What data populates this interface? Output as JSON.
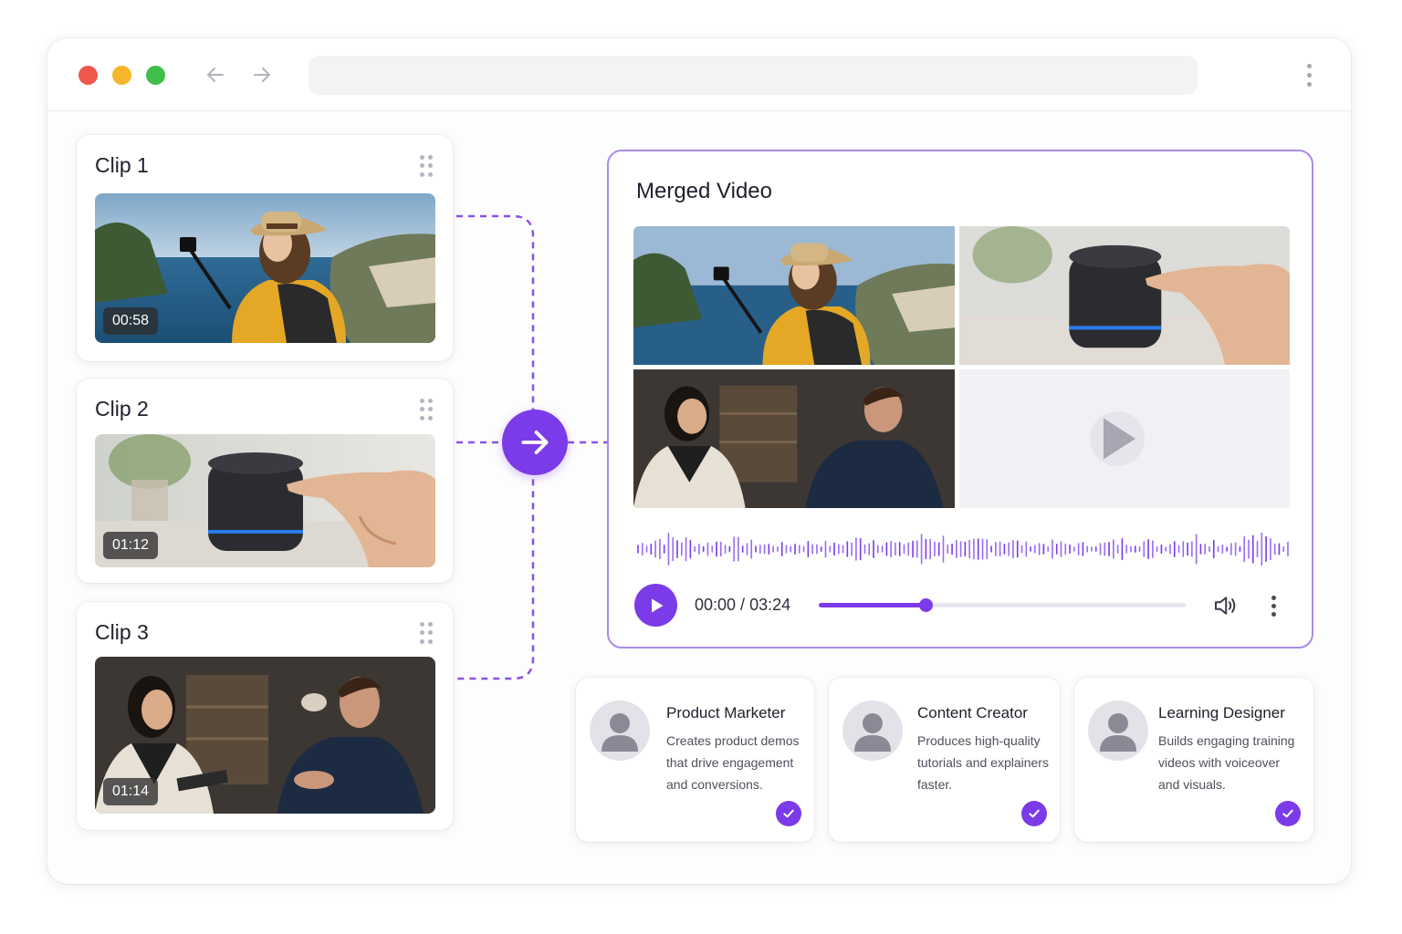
{
  "browser": {
    "window_controls": [
      "close",
      "minimize",
      "maximize"
    ],
    "nav_icons": [
      "arrow-left-icon",
      "arrow-right-icon"
    ],
    "menu_icon": "kebab-vertical-icon"
  },
  "clips": [
    {
      "title": "Clip 1",
      "duration": "00:58"
    },
    {
      "title": "Clip 2",
      "duration": "01:12"
    },
    {
      "title": "Clip 3",
      "duration": "01:14"
    }
  ],
  "merge": {
    "icon": "arrow-right-icon"
  },
  "merged": {
    "title": "Merged Video",
    "player": {
      "current_time": "00:00",
      "separator": " / ",
      "total_time": "03:24",
      "progress": 0.29
    }
  },
  "personas": [
    {
      "title": "Product Marketer",
      "description": "Creates product demos that drive engagement and conversions."
    },
    {
      "title": "Content Creator",
      "description": "Produces high-quality tutorials and explainers faster."
    },
    {
      "title": "Learning Designer",
      "description": "Builds engaging training videos with voiceover and visuals."
    }
  ],
  "colors": {
    "accent": "#7b3be8",
    "accent_light": "#a98be8"
  }
}
